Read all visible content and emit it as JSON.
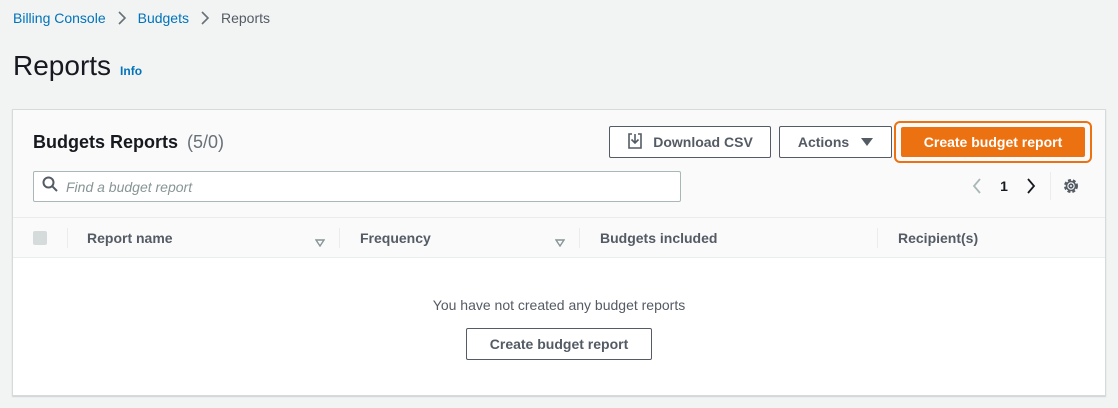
{
  "breadcrumb": {
    "items": [
      "Billing Console",
      "Budgets"
    ],
    "current": "Reports"
  },
  "header": {
    "title": "Reports",
    "info": "Info"
  },
  "panel": {
    "title": "Budgets Reports",
    "count": "(5/0)",
    "download_label": "Download CSV",
    "actions_label": "Actions",
    "create_label": "Create budget report",
    "accent_color": "#ec7211"
  },
  "search": {
    "placeholder": "Find a budget report",
    "value": ""
  },
  "pagination": {
    "current_page": "1"
  },
  "table": {
    "columns": [
      "Report name",
      "Frequency",
      "Budgets included",
      "Recipient(s)"
    ],
    "rows": []
  },
  "empty_state": {
    "message": "You have not created any budget reports",
    "button_label": "Create budget report"
  },
  "icons": {
    "breadcrumb_separator": "chevron-right-icon",
    "download": "download-icon",
    "actions_caret": "caret-down-icon",
    "search": "search-icon",
    "prev": "chevron-left-icon",
    "next": "chevron-right-icon",
    "settings": "gear-icon",
    "sort": "sort-down-icon"
  }
}
